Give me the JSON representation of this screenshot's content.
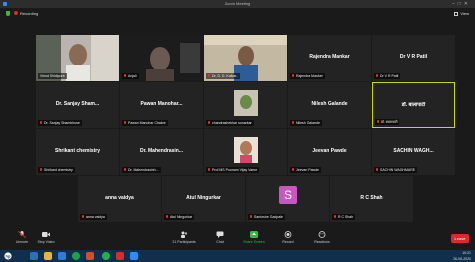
{
  "window": {
    "title": "Zoom Meeting"
  },
  "meeting": {
    "recording_label": "Recording",
    "view_label": "View"
  },
  "tiles": [
    {
      "id": "t1",
      "name": "Vinod Shidipure",
      "big": "",
      "video": true
    },
    {
      "id": "t2",
      "name": "Anjali",
      "big": "",
      "video": true
    },
    {
      "id": "t3",
      "name": "Dr. D. D. Kulkar..",
      "big": "",
      "video": true
    },
    {
      "id": "t4",
      "name": "Rajendra Manker",
      "big": "Rajendra Mankar",
      "video": false
    },
    {
      "id": "t5",
      "name": "Dr V R Patil",
      "big": "Dr V R Patil",
      "video": false
    },
    {
      "id": "t6",
      "name": "Dr. Sanjay Shambhuse",
      "big": "Dr. Sanjay Sham...",
      "video": false
    },
    {
      "id": "t7",
      "name": "Pawan Manohar Chakre",
      "big": "Pawan Manohar...",
      "video": false
    },
    {
      "id": "t8",
      "name": "chandrashekhar sonarkar",
      "big": "",
      "video": true
    },
    {
      "id": "t9",
      "name": "Nilesh Galande",
      "big": "Nilesh Galande",
      "video": false
    },
    {
      "id": "t10",
      "name": "डॉ. बालापाटी",
      "big": "डॉ. बालापाटी",
      "video": false
    },
    {
      "id": "t11",
      "name": "Shrikant chemistry",
      "big": "Shrikant chemistry",
      "video": false
    },
    {
      "id": "t12",
      "name": "Dr. Mahendrasinh...",
      "big": "Dr. Mahendrasin...",
      "video": false
    },
    {
      "id": "t13",
      "name": "Prof MS Poonam Vijay Varne",
      "big": "",
      "video": true
    },
    {
      "id": "t14",
      "name": "Jeevan Pawde",
      "big": "Jeevan Pawde",
      "video": false
    },
    {
      "id": "t15",
      "name": "SACHIN WAGHMARE",
      "big": "SACHIN WAGH...",
      "video": false
    },
    {
      "id": "t16",
      "name": "anna vaidya",
      "big": "anna vaidya",
      "video": false
    },
    {
      "id": "t17",
      "name": "Atul Ningurkar",
      "big": "Atul Ningurkar",
      "video": false
    },
    {
      "id": "t18",
      "name": "Santoshe Gadpale",
      "big": "",
      "avatar": "S",
      "video": false
    },
    {
      "id": "t19",
      "name": "R C Shah",
      "big": "R C Shah",
      "video": false
    }
  ],
  "toolbar": {
    "unmute": "Unmute",
    "stop_video": "Stop Video",
    "participants": "Participants",
    "participants_count": "21",
    "chat": "Chat",
    "share_screen": "Share Screen",
    "record": "Record",
    "reactions": "Reactions",
    "leave": "Leave"
  },
  "taskbar": {
    "time": "10:21",
    "date": "26-06-2020"
  },
  "colors": {
    "highlight": "#c8d900",
    "share_green": "#2bbd4a",
    "leave_red": "#e02828",
    "avatar_bg": "#c857c2"
  }
}
